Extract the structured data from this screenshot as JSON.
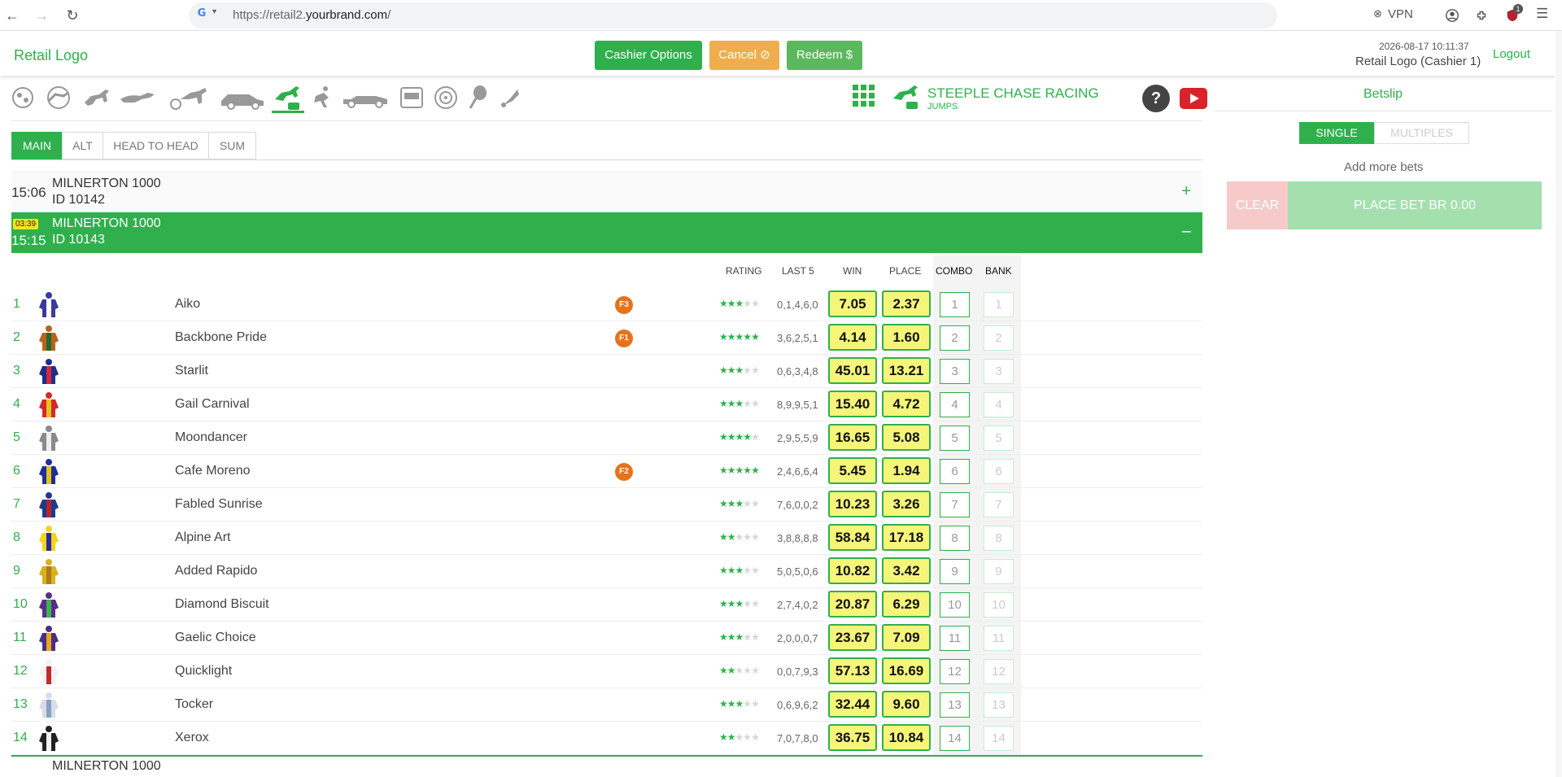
{
  "browser": {
    "url_prefix": "https://retail2.",
    "url_domain": "yourbrand.com",
    "url_suffix": "/",
    "vpn_label": "VPN",
    "ext_badge": "1"
  },
  "header": {
    "logo": "Retail Logo",
    "cashier_options": "Cashier Options",
    "cancel": "Cancel ⊘",
    "redeem": "Redeem $",
    "datetime": "2026-08-17 10:11:37",
    "user": "Retail Logo (Cashier 1)",
    "logout": "Logout"
  },
  "sport": {
    "title": "STEEPLE CHASE RACING",
    "subtitle": "JUMPS",
    "help": "?"
  },
  "tabs": [
    "MAIN",
    "ALT",
    "HEAD TO HEAD",
    "SUM"
  ],
  "races": {
    "closed": {
      "time": "15:06",
      "name": "MILNERTON 1000",
      "id": "ID 10142",
      "toggle": "+"
    },
    "open": {
      "countdown": "03:39",
      "time": "15:15",
      "name": "MILNERTON 1000",
      "id": "ID 10143",
      "toggle": "–"
    },
    "next": {
      "name": "MILNERTON 1000"
    }
  },
  "columns": {
    "rating": "RATING",
    "last5": "LAST 5",
    "win": "WIN",
    "place": "PLACE",
    "combo": "COMBO",
    "bank": "BANK"
  },
  "runners": [
    {
      "num": "1",
      "name": "Aiko",
      "fav": "F3",
      "rating": 3,
      "last5": "0,1,4,6,0",
      "win": "7.05",
      "place": "2.37",
      "c1": "#3a3aa0",
      "c2": "#ffffff"
    },
    {
      "num": "2",
      "name": "Backbone Pride",
      "fav": "F1",
      "rating": 5,
      "last5": "3,6,2,5,1",
      "win": "4.14",
      "place": "1.60",
      "c1": "#b8621e",
      "c2": "#1f6b2a"
    },
    {
      "num": "3",
      "name": "Starlit",
      "fav": "",
      "rating": 3,
      "last5": "0,6,3,4,8",
      "win": "45.01",
      "place": "13.21",
      "c1": "#1b2e8c",
      "c2": "#d6263a"
    },
    {
      "num": "4",
      "name": "Gail Carnival",
      "fav": "",
      "rating": 3,
      "last5": "8,9,9,5,1",
      "win": "15.40",
      "place": "4.72",
      "c1": "#d22a2a",
      "c2": "#e6c21a"
    },
    {
      "num": "5",
      "name": "Moondancer",
      "fav": "",
      "rating": 4,
      "last5": "2,9,5,5,9",
      "win": "16.65",
      "place": "5.08",
      "c1": "#8a8a8a",
      "c2": "#eeeeee"
    },
    {
      "num": "6",
      "name": "Cafe Moreno",
      "fav": "F2",
      "rating": 5,
      "last5": "2,4,6,6,4",
      "win": "5.45",
      "place": "1.94",
      "c1": "#1d2f9a",
      "c2": "#e5c21a"
    },
    {
      "num": "7",
      "name": "Fabled Sunrise",
      "fav": "",
      "rating": 3,
      "last5": "7,6,0,0,2",
      "win": "10.23",
      "place": "3.26",
      "c1": "#1e3b8c",
      "c2": "#b5232d"
    },
    {
      "num": "8",
      "name": "Alpine Art",
      "fav": "",
      "rating": 2,
      "last5": "3,8,8,8,8",
      "win": "58.84",
      "place": "17.18",
      "c1": "#f0d51a",
      "c2": "#2a2a9c"
    },
    {
      "num": "9",
      "name": "Added Rapido",
      "fav": "",
      "rating": 3,
      "last5": "5,0,5,0,6",
      "win": "10.82",
      "place": "3.42",
      "c1": "#d8b21e",
      "c2": "#b07a16"
    },
    {
      "num": "10",
      "name": "Diamond Biscuit",
      "fav": "",
      "rating": 3,
      "last5": "2,7,4,0,2",
      "win": "20.87",
      "place": "6.29",
      "c1": "#5a2d8c",
      "c2": "#3bb54a"
    },
    {
      "num": "11",
      "name": "Gaelic Choice",
      "fav": "",
      "rating": 3,
      "last5": "2,0,0,0,7",
      "win": "23.67",
      "place": "7.09",
      "c1": "#4a2d8a",
      "c2": "#e5a81a"
    },
    {
      "num": "12",
      "name": "Quicklight",
      "fav": "",
      "rating": 2,
      "last5": "0,0,7,9,3",
      "win": "57.13",
      "place": "16.69",
      "c1": "#f2f2f2",
      "c2": "#c22a2a"
    },
    {
      "num": "13",
      "name": "Tocker",
      "fav": "",
      "rating": 3,
      "last5": "0,6,9,6,2",
      "win": "32.44",
      "place": "9.60",
      "c1": "#d7dde8",
      "c2": "#8aa0c2"
    },
    {
      "num": "14",
      "name": "Xerox",
      "fav": "",
      "rating": 2,
      "last5": "7,0,7,8,0",
      "win": "36.75",
      "place": "10.84",
      "c1": "#222222",
      "c2": "#f2f2f2"
    }
  ],
  "betslip": {
    "title": "Betslip",
    "single": "SINGLE",
    "multiples": "MULTIPLES",
    "add_more": "Add more bets",
    "clear": "CLEAR",
    "place_bet": "PLACE BET BR 0.00"
  },
  "colors": {
    "accent": "#2fb04d",
    "odds_bg": "#f5f57a",
    "fav_badge": "#e8711b",
    "cancel": "#f0ad4e"
  }
}
